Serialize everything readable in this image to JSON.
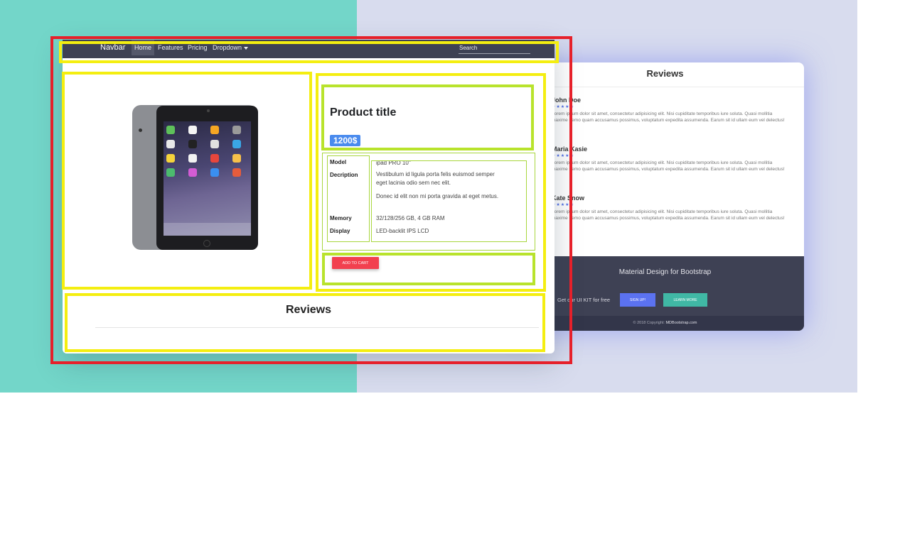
{
  "navbar": {
    "brand": "Navbar",
    "links": [
      "Home",
      "Features",
      "Pricing",
      "Dropdown"
    ],
    "search_placeholder": "Search"
  },
  "product": {
    "title": "Product title",
    "price": "1200$",
    "specs": [
      {
        "key": "Model",
        "value": "ipad PRO 10''"
      },
      {
        "key": "Decription",
        "value": "Vestibulum id ligula porta felis euismod semper eget lacinia odio sem nec elit."
      },
      {
        "key": "",
        "value": "Donec id elit non mi porta gravida at eget metus."
      },
      {
        "key": "Memory",
        "value": "32/128/256 GB, 4 GB RAM"
      },
      {
        "key": "Display",
        "value": "LED-backlit IPS LCD"
      }
    ],
    "add_to_cart": "ADD TO CART"
  },
  "reviews": {
    "title": "Reviews"
  },
  "back_card": {
    "title": "Reviews",
    "reviews": [
      {
        "name": "John Doe",
        "stars": "★★★★★",
        "text": "Lorem ipsum dolor sit amet, consectetur adipisicing elit. Nisi cupiditate temporibus iure soluta. Quasi mollitia maxime nemo quam accusamus possimus, voluptatum expedita assumenda. Earum sit id ullam eum vel delectus!"
      },
      {
        "name": "Maria Kasie",
        "stars": "★★★★★",
        "text": "Lorem ipsum dolor sit amet, consectetur adipisicing elit. Nisi cupiditate temporibus iure soluta. Quasi mollitia maxime nemo quam accusamus possimus, voluptatum expedita assumenda. Earum sit id ullam eum vel delectus!"
      },
      {
        "name": "Kate Snow",
        "stars": "★★★★★",
        "text": "Lorem ipsum dolor sit amet, consectetur adipisicing elit. Nisi cupiditate temporibus iure soluta. Quasi mollitia maxime nemo quam accusamus possimus, voluptatum expedita assumenda. Earum sit id ullam eum vel delectus!"
      }
    ],
    "footer_title": "Material Design for Bootstrap",
    "kit_text": "Get our UI KIT for free",
    "signup": "SIGN UP!",
    "learn_more": "LEARN MORE",
    "copyright": "© 2018 Copyright:",
    "copyright_link": "MDBootstrap.com"
  },
  "colors": {
    "teal_bg": "#73d6c9",
    "lavender_bg": "#d8dcee",
    "navbar": "#3e4154",
    "price_badge": "#4a8bee",
    "add_to_cart": "#f2404f",
    "annotation_red": "#e6202a",
    "annotation_yellow": "#f4ee10",
    "annotation_green": "#b8e32c"
  }
}
